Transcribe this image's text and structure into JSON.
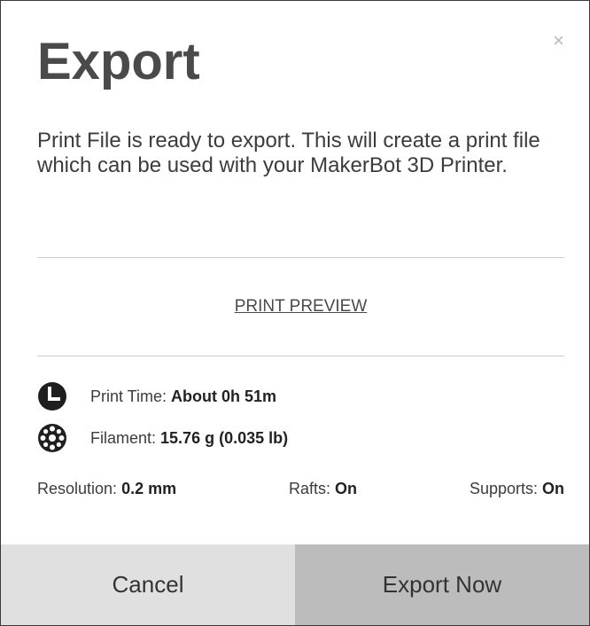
{
  "dialog": {
    "close_glyph": "×",
    "title": "Export",
    "description": "Print File is ready to export. This will create a print file which can be used with your MakerBot 3D Printer.",
    "preview_link": "PRINT PREVIEW",
    "stats": {
      "print_time_label": "Print Time:",
      "print_time_value": "About 0h 51m",
      "filament_label": "Filament:",
      "filament_value": "15.76 g (0.035 lb)"
    },
    "settings": {
      "resolution_label": "Resolution:",
      "resolution_value": "0.2 mm",
      "rafts_label": "Rafts:",
      "rafts_value": "On",
      "supports_label": "Supports:",
      "supports_value": "On"
    },
    "buttons": {
      "cancel": "Cancel",
      "export": "Export Now"
    }
  },
  "icons": {
    "print_time": "clock-icon",
    "filament": "filament-spool-icon",
    "close": "close-icon"
  },
  "colors": {
    "title": "#4a4a4a",
    "cancel_bg": "#e0e0e0",
    "export_bg": "#bcbcbc",
    "icon": "#1f1f1f"
  }
}
